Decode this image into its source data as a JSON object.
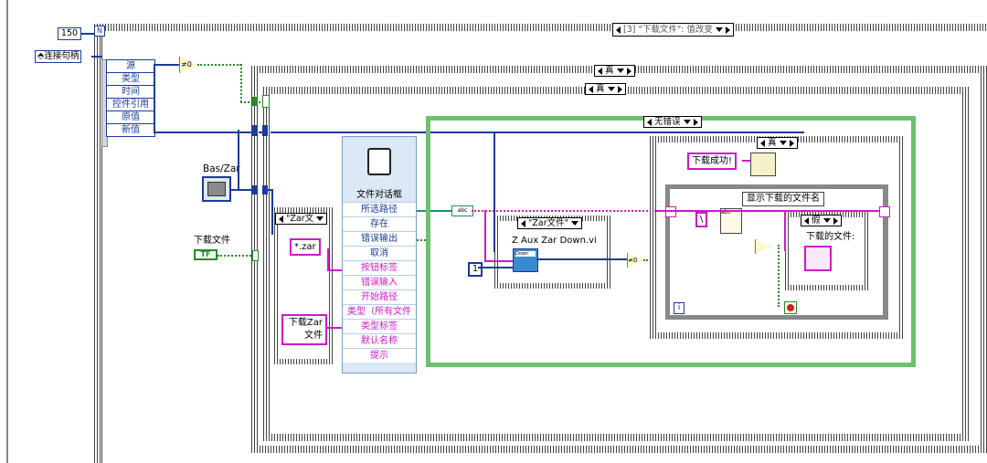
{
  "loop_count": "150",
  "connection_handle_label": "连接句柄",
  "event_selector": "[3] \"下载文件\": 值改变",
  "event_fields": [
    "源",
    "类型",
    "时间",
    "控件引用",
    "原值",
    "新值"
  ],
  "neq0_label": "≠0",
  "case_true_outer": "真",
  "case_true_inner": "真",
  "bas_zar_label": "Bas/Zar",
  "download_button_label": "下载文件",
  "download_button_tf": "TF",
  "filter_case_label": "\"Zar文",
  "pattern_constant": "*.zar",
  "type_label_constant": "下载Zar\n文件",
  "file_dialog": {
    "title": "文件对话框",
    "outputs": [
      "所选路径",
      "存在",
      "错误输出",
      "取消"
    ],
    "inputs": [
      "按钮标签",
      "错误输入",
      "开始路径",
      "类型（所有文件",
      "类型标签",
      "默认名称",
      "提示"
    ]
  },
  "no_error_case": "无错误",
  "zar_file_case": "\"Zar文件\"",
  "vi_name": "Z Aux Zar Down.vi",
  "vi_icon_label": "Down",
  "constant_one": "1",
  "true_case_3": "真",
  "success_message": "下载成功!",
  "show_filename_label": "显示下载的文件名",
  "backslash_constant": "\\",
  "false_case": "假",
  "downloaded_file_label": "下载的文件:",
  "info_icon": "i",
  "icons": [
    "file-dialog-icon",
    "vi-icon",
    "stop-icon",
    "message-dialog-icon"
  ],
  "colors": {
    "wire_blue": "#1a3c9a",
    "wire_pink": "#d018c8",
    "wire_green": "#2a8a2a",
    "frame_green": "#6ec16e",
    "dialog_bg": "#dbe8f5"
  }
}
